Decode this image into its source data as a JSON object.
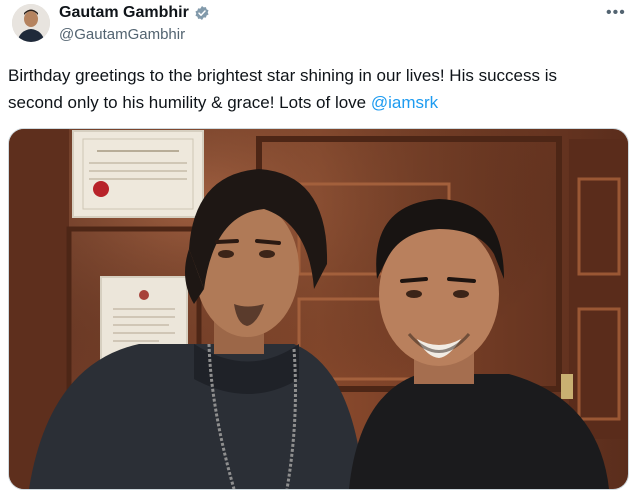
{
  "tweet": {
    "author_name": "Gautam Gambhir",
    "author_handle": "@GautamGambhir",
    "text_line1": "Birthday greetings to the brightest star shining in our lives! His success is",
    "text_line2_prefix": "second only to his humility & grace! Lots of love ",
    "mention": "@iamsrk",
    "verified": true
  },
  "icons": {
    "verified": "verified-badge-icon",
    "more": "more-options-icon"
  },
  "colors": {
    "link": "#1d9bf0",
    "secondary_text": "#536471",
    "verified_badge": "#829aab"
  }
}
